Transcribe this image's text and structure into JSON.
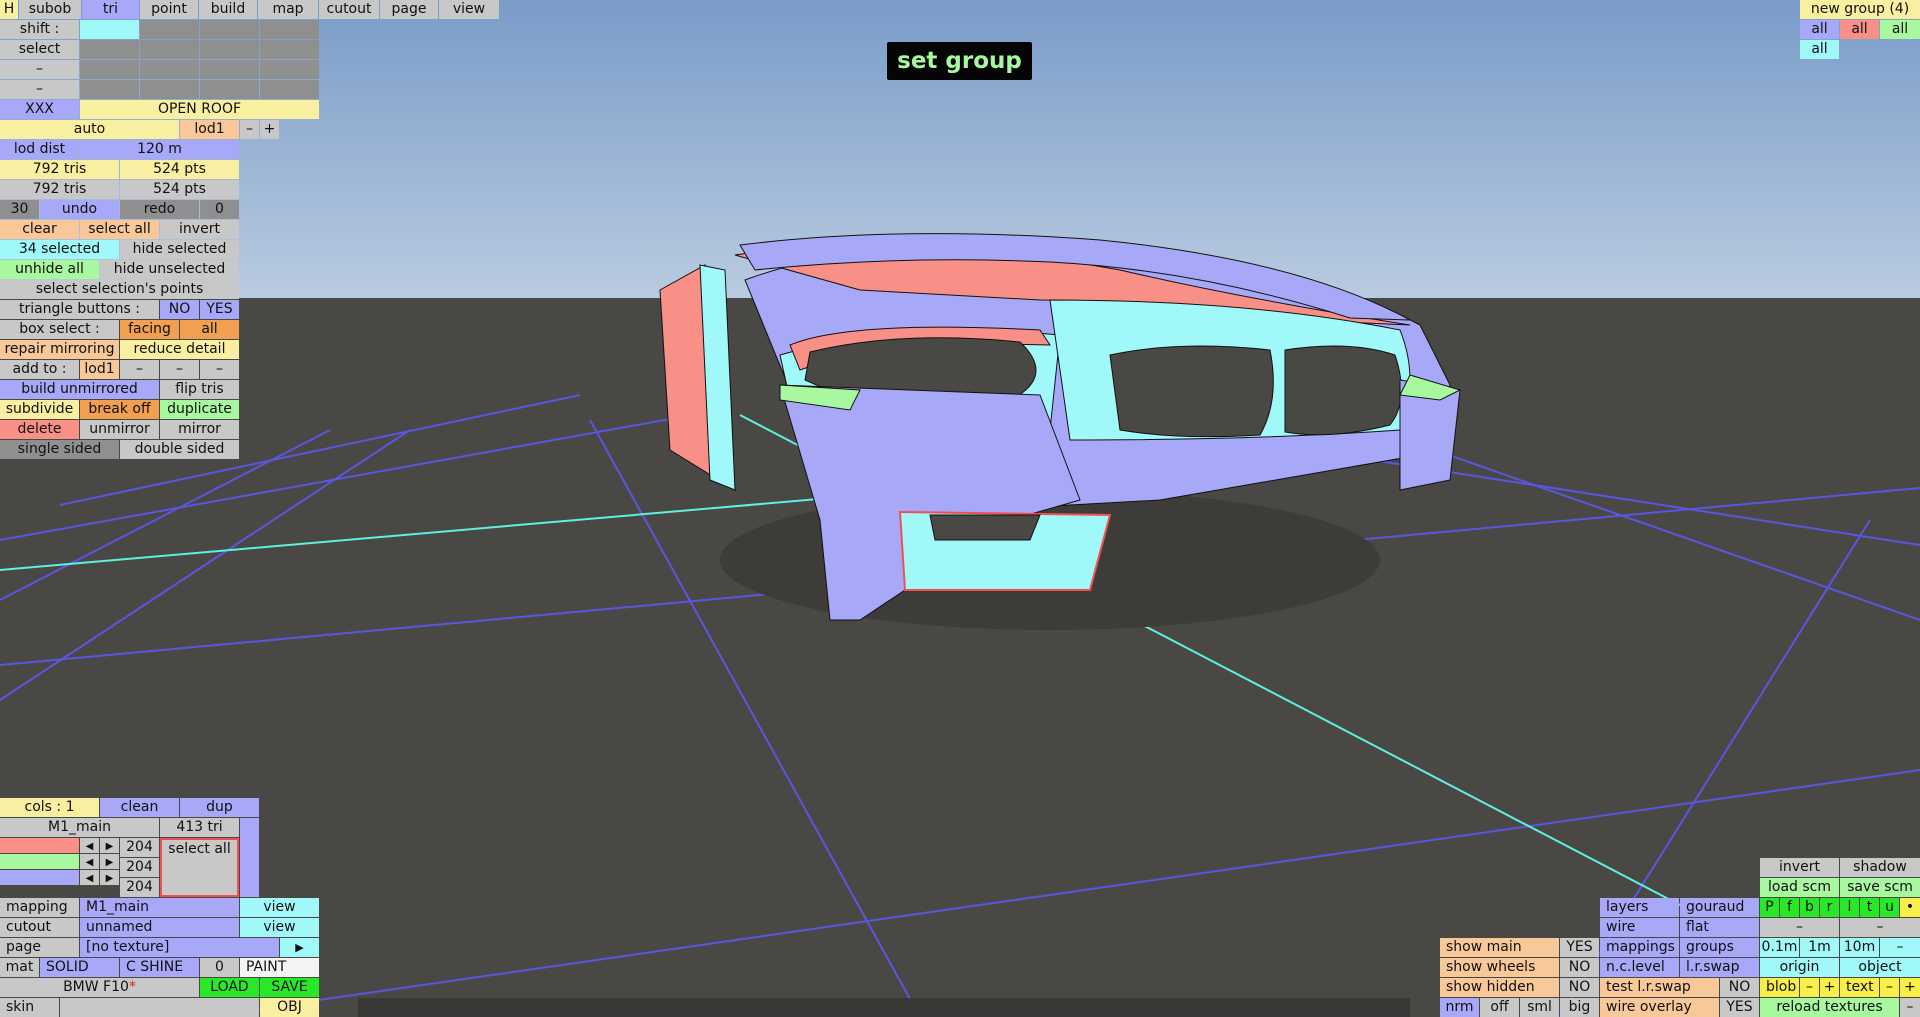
{
  "banner": "set group",
  "top_menu": {
    "h": "H",
    "subob": "subob",
    "tri": "tri",
    "point": "point",
    "build": "build",
    "map": "map",
    "cutout": "cutout",
    "page": "page",
    "view": "view"
  },
  "left_panel": {
    "shift": "shift :",
    "select": "select",
    "dash1": "–",
    "dash2": "–",
    "xxx": "XXX",
    "group_name": "OPEN ROOF",
    "auto": "auto",
    "lod": "lod1",
    "minus": "–",
    "plus": "+",
    "lod_dist_label": "lod dist",
    "lod_dist_value": "120 m",
    "tris1": "792 tris",
    "pts1": "524 pts",
    "tris2": "792 tris",
    "pts2": "524 pts",
    "undo_count": "30",
    "undo": "undo",
    "redo": "redo",
    "redo_count": "0",
    "clear": "clear",
    "select_all": "select all",
    "invert": "invert",
    "selected": "34 selected",
    "hide_selected": "hide selected",
    "unhide_all": "unhide all",
    "hide_unselected": "hide unselected",
    "select_points": "select selection's points",
    "tri_buttons": "triangle buttons :",
    "no": "NO",
    "yes": "YES",
    "box_select": "box select :",
    "facing": "facing",
    "all": "all",
    "repair_mirroring": "repair mirroring",
    "reduce_detail": "reduce detail",
    "add_to": "add to :",
    "add_lod": "lod1",
    "add_d1": "–",
    "add_d2": "–",
    "add_d3": "–",
    "build_unmirrored": "build unmirrored",
    "flip_tris": "flip tris",
    "subdivide": "subdivide",
    "break_off": "break off",
    "duplicate": "duplicate",
    "delete": "delete",
    "unmirror": "unmirror",
    "mirror": "mirror",
    "single_sided": "single sided",
    "double_sided": "double sided"
  },
  "color_panel": {
    "cols": "cols : 1",
    "clean": "clean",
    "dup": "dup",
    "material": "M1_main",
    "tri_count": "413 tri",
    "r": "204",
    "g": "204",
    "b": "204",
    "select_all": "select all",
    "swatch_red": "#f89088",
    "swatch_green": "#a8f8a0",
    "swatch_blue": "#a8a8f8"
  },
  "bottom_left": {
    "mapping": "mapping",
    "mapping_value": "M1_main",
    "view1": "view",
    "cutout": "cutout",
    "cutout_value": "unnamed",
    "view2": "view",
    "page": "page",
    "page_value": "[no texture]",
    "arrow": "▶",
    "mat": "mat",
    "solid": "SOLID",
    "cshine": "C SHINE",
    "zero": "0",
    "paint": "PAINT",
    "model": "BMW F10",
    "star": "*",
    "load": "LOAD",
    "save": "SAVE",
    "skin": "skin",
    "obj": "OBJ"
  },
  "top_right": {
    "new_group": "new group (4)",
    "all1": "all",
    "all2": "all",
    "all3": "all",
    "all4": "all"
  },
  "bottom_right": {
    "invert": "invert",
    "shadow": "shadow",
    "load_scm": "load scm",
    "save_scm": "save scm",
    "layers": "layers",
    "gouraud": "gouraud",
    "wire": "wire",
    "flat": "flat",
    "pf": [
      "P",
      "f",
      "b",
      "r",
      "l",
      "t",
      "u",
      "•"
    ],
    "dash1": "–",
    "dash2": "–",
    "show_main": "show main",
    "show_main_v": "YES",
    "mappings": "mappings",
    "groups": "groups",
    "d01": "0.1m",
    "d1": "1m",
    "d10": "10m",
    "dminus": "–",
    "show_wheels": "show wheels",
    "show_wheels_v": "NO",
    "nclevel": "n.c.level",
    "lrswap": "l.r.swap",
    "origin": "origin",
    "object": "object",
    "show_hidden": "show hidden",
    "show_hidden_v": "NO",
    "test_lr": "test l.r.swap",
    "test_lr_v": "NO",
    "blob": "blob",
    "bm": "–",
    "bp": "+",
    "text": "text",
    "tm": "–",
    "tp": "+",
    "nrm": "nrm",
    "off": "off",
    "sml": "sml",
    "big": "big",
    "wire_overlay": "wire overlay",
    "wire_overlay_v": "YES",
    "reload_textures": "reload textures",
    "rt_minus": "–"
  }
}
